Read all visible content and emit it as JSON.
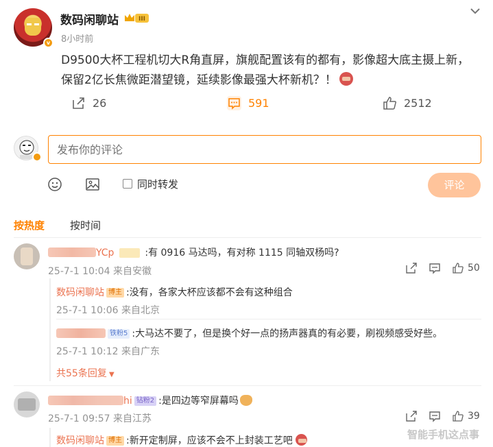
{
  "post": {
    "author": "数码闲聊站",
    "level_badge": "III",
    "time": "8小时前",
    "text": "D9500大杯工程机切大R角直屏，旗舰配置该有的都有，影像超大底主摄上新，保留2亿长焦微距潜望镜，延续影像最强大杯新机？！",
    "reposts": "26",
    "comments": "591",
    "likes": "2512"
  },
  "composer": {
    "placeholder": "发布你的评论",
    "repost_label": "同时转发",
    "submit_label": "评论"
  },
  "sort": {
    "hot": "按热度",
    "time": "按时间"
  },
  "comments": [
    {
      "name": "YCp",
      "text": ":有 0916 马达吗，有对称 1115 同轴双杨吗?",
      "meta": "25-7-1 10:04 来自安徽",
      "likes": "50",
      "replies": [
        {
          "name": "数码闲聊站",
          "tag": "博主",
          "text": ":没有，各家大杯应该都不会有这种组合",
          "meta": "25-7-1 10:06 来自北京"
        },
        {
          "name": "",
          "tag": "铁粉5",
          "text": ":大马达不要了，但是换个好一点的扬声器真的有必要，刷视频感受好些。",
          "meta": "25-7-1 10:12 来自广东"
        }
      ],
      "more": "共55条回复"
    },
    {
      "name": "hi",
      "tag": "钻粉2",
      "text": ":是四边等窄屏幕吗",
      "meta": "25-7-1 09:57 来自江苏",
      "likes": "39",
      "replies": [
        {
          "name": "数码闲聊站",
          "tag": "博主",
          "text": ":新开定制屏，应该不会不上封装工艺吧"
        }
      ]
    }
  ],
  "watermark": "智能手机这点事",
  "colors": {
    "accent": "#ff8200",
    "name": "#eb7350",
    "submit_disabled": "#ffc49b"
  }
}
